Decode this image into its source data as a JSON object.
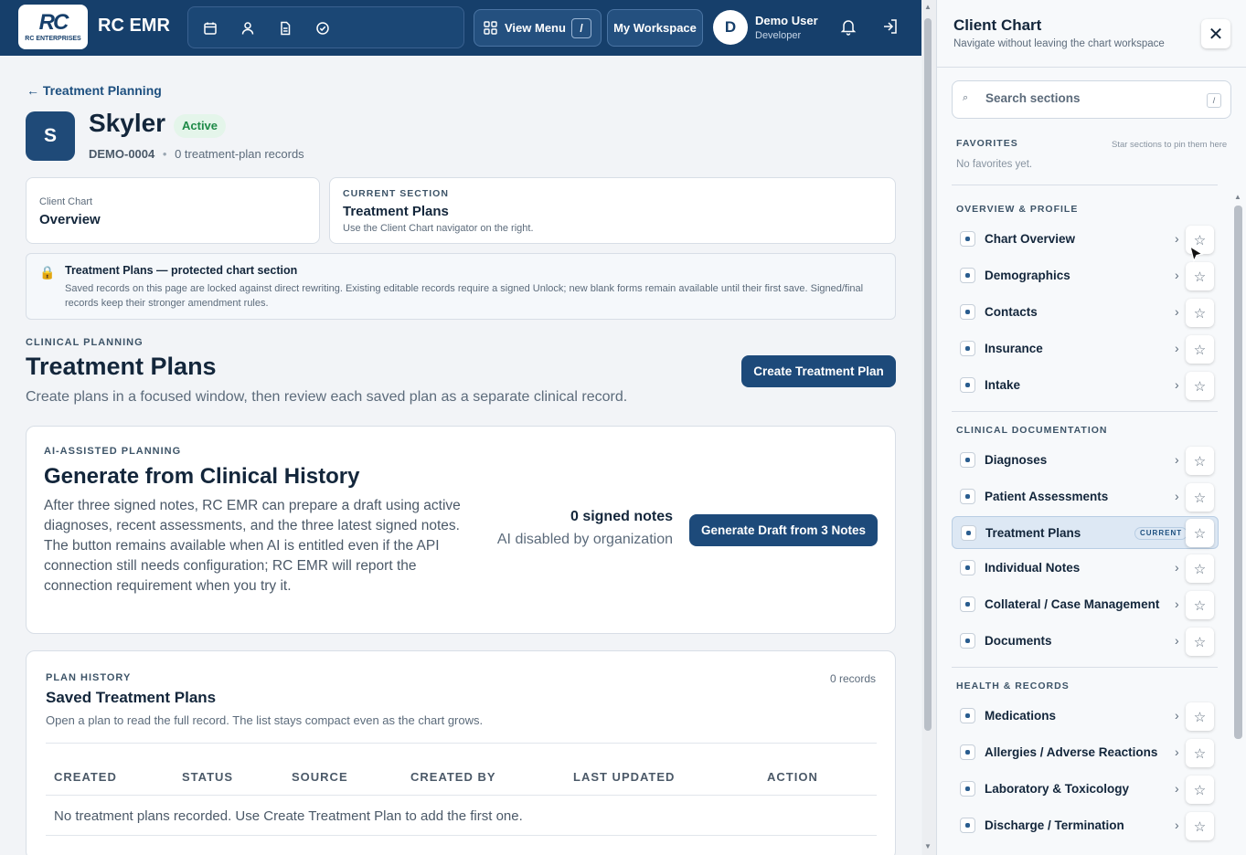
{
  "header": {
    "logo_text": "RC ENTERPRISES",
    "brand": "RC EMR",
    "view_menu_label": "View Menu",
    "view_menu_key": "/",
    "workspace_label": "My Workspace",
    "user_initial": "D",
    "user_name": "Demo User",
    "user_role": "Developer",
    "icons": [
      "calendar-icon",
      "person-icon",
      "document-icon",
      "check-circle-icon"
    ]
  },
  "patient": {
    "back_label": "← Treatment Planning",
    "initial": "S",
    "name": "Skyler",
    "status": "Active",
    "mrn": "DEMO-0004",
    "record_count": "0 treatment-plan records"
  },
  "context": {
    "chart_label": "Client Chart",
    "chart_value": "Overview",
    "section_label": "CURRENT SECTION",
    "section_value": "Treatment Plans",
    "section_hint": "Use the Client Chart navigator on the right."
  },
  "notice": {
    "title": "Treatment Plans — protected chart section",
    "body": "Saved records on this page are locked against direct rewriting. Existing editable records require a signed Unlock; new blank forms remain available until their first save. Signed/final records keep their stronger amendment rules."
  },
  "section": {
    "eyebrow": "CLINICAL PLANNING",
    "title": "Treatment Plans",
    "description": "Create plans in a focused window, then review each saved plan as a separate clinical record.",
    "create_button": "Create Treatment Plan"
  },
  "ai": {
    "eyebrow": "AI-ASSISTED PLANNING",
    "title": "Generate from Clinical History",
    "body": "After three signed notes, RC EMR can prepare a draft using active diagnoses, recent assessments, and the three latest signed notes. The button remains available when AI is entitled even if the API connection still needs configuration; RC EMR will report the connection requirement when you try it.",
    "signed_notes": "0 signed notes",
    "ai_status": "AI disabled by organization",
    "generate_button": "Generate Draft from 3 Notes"
  },
  "history": {
    "eyebrow": "PLAN HISTORY",
    "title": "Saved Treatment Plans",
    "description": "Open a plan to read the full record. The list stays compact even as the chart grows.",
    "count": "0 records",
    "columns": [
      "CREATED",
      "STATUS",
      "SOURCE",
      "CREATED BY",
      "LAST UPDATED",
      "ACTION"
    ],
    "empty": "No treatment plans recorded. Use Create Treatment Plan to add the first one."
  },
  "panel": {
    "title": "Client Chart",
    "subtitle": "Navigate without leaving the chart workspace",
    "close_label": "✕",
    "search_placeholder": "Search sections",
    "search_key": "/",
    "favorites_label": "FAVORITES",
    "favorites_hint": "Star sections to pin them here",
    "favorites_empty": "No favorites yet.",
    "groups": [
      {
        "label": "OVERVIEW & PROFILE",
        "items": [
          "Chart Overview",
          "Demographics",
          "Contacts",
          "Insurance",
          "Intake"
        ]
      },
      {
        "label": "CLINICAL DOCUMENTATION",
        "items": [
          "Diagnoses",
          "Patient Assessments",
          "Treatment Plans",
          "Individual Notes",
          "Collateral / Case Management",
          "Documents"
        ]
      },
      {
        "label": "HEALTH & RECORDS",
        "items": [
          "Medications",
          "Allergies / Adverse Reactions",
          "Laboratory & Toxicology",
          "Discharge / Termination"
        ]
      }
    ],
    "current_tag": "CURRENT"
  },
  "colors": {
    "header_bg": "#163f6b",
    "primary": "#1d4a7a",
    "active_green": "#1e8a47"
  }
}
